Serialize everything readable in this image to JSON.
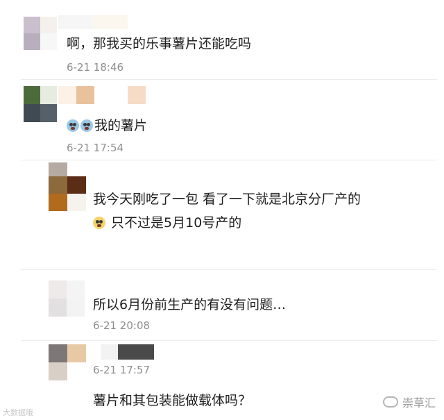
{
  "comments": [
    {
      "text": "啊，那我买的乐事薯片还能吃吗",
      "time": "6-21 18:46"
    },
    {
      "text": "我的薯片",
      "time": "6-21 17:54",
      "emoji": [
        "scream-emoji",
        "scream-emoji"
      ]
    },
    {
      "text_line1": "我今天刚吃了一包 看了一下就是北京分厂产的",
      "text_line2": "只不过是5月10号产的",
      "emoji": [
        "crying-emoji"
      ]
    },
    {
      "text": "所以6月份前生产的有没有问题…",
      "time": "6-21 20:08"
    },
    {
      "text": "薯片和其包装能做载体吗？",
      "time": "6-21 17:57"
    }
  ],
  "watermark": {
    "left": "大数据哦",
    "right": "崇草汇"
  }
}
